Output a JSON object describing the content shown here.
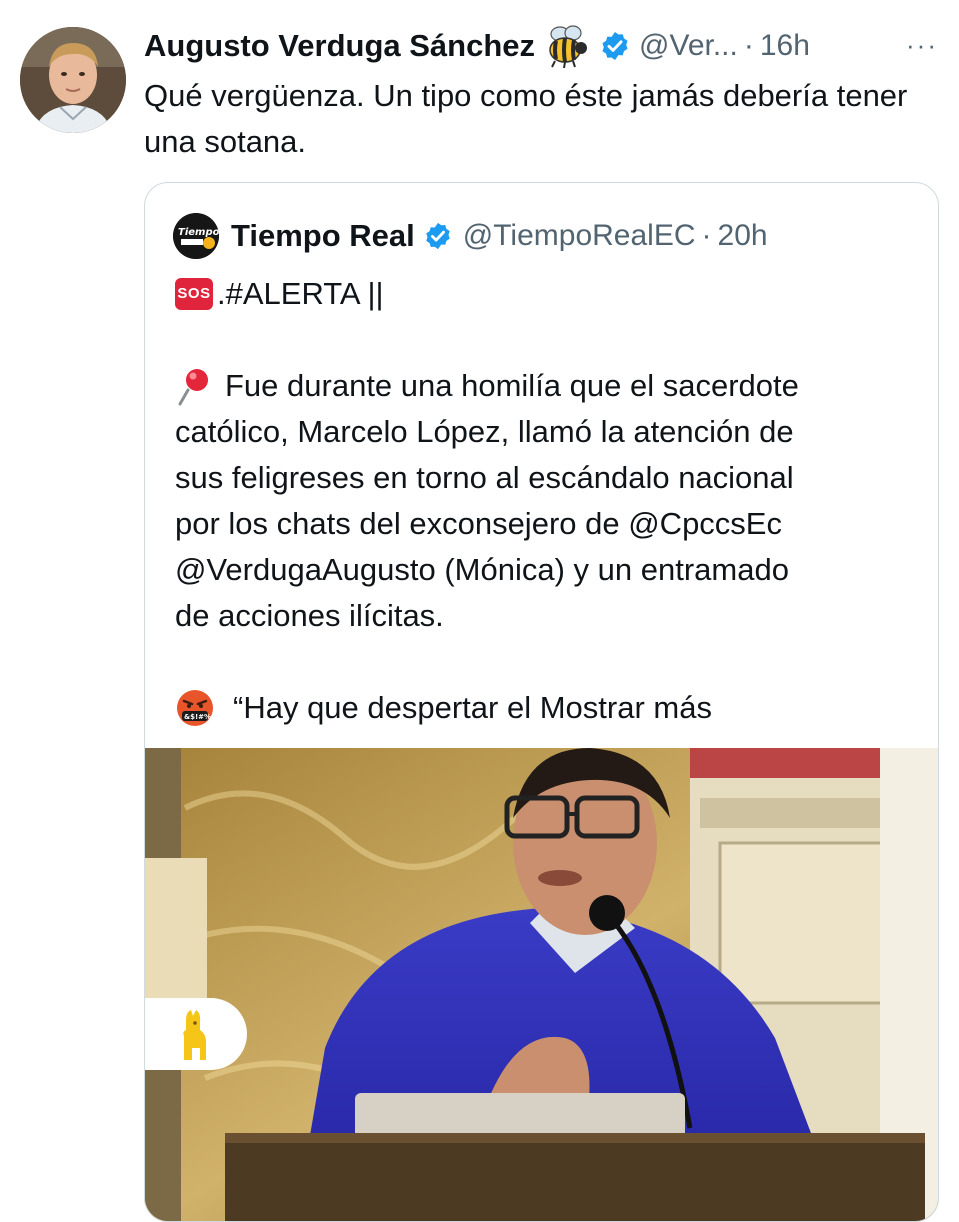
{
  "tweet": {
    "author_name": "Augusto Verduga Sánchez",
    "author_emoji": "bee-emoji",
    "handle": "@Ver...",
    "separator": "·",
    "time": "16h",
    "more_label": "···",
    "text": "Qué vergüenza. Un tipo como éste jamás debería tener una sotana.",
    "verified_color": "#1d9bf0"
  },
  "quote": {
    "author_name": "Tiempo Real",
    "handle": "@TiempoRealEC",
    "separator": "·",
    "time": "20h",
    "sos_label": "SOS",
    "line1": ".#ALERTA ||",
    "paragraph_lines": [
      "Fue durante una homilía que el sacerdote",
      "católico, Marcelo López, llamó la atención de",
      "sus feligreses en torno al escándalo nacional",
      "por los chats del exconsejero de @CpccsEc",
      "@VerdugaAugusto (Mónica) y un entramado",
      "de acciones ilícitas."
    ],
    "quote_line": "“Hay que despertar el",
    "show_more": "Mostrar más",
    "avatar_text": "Tiempo",
    "icons": [
      "pin-emoji",
      "angry-cursing-emoji",
      "sos-emoji",
      "verified-badge-icon"
    ]
  },
  "media": {
    "type": "video-thumbnail",
    "badge_icon": "llama-icon",
    "badge_color": "#f5c518"
  }
}
